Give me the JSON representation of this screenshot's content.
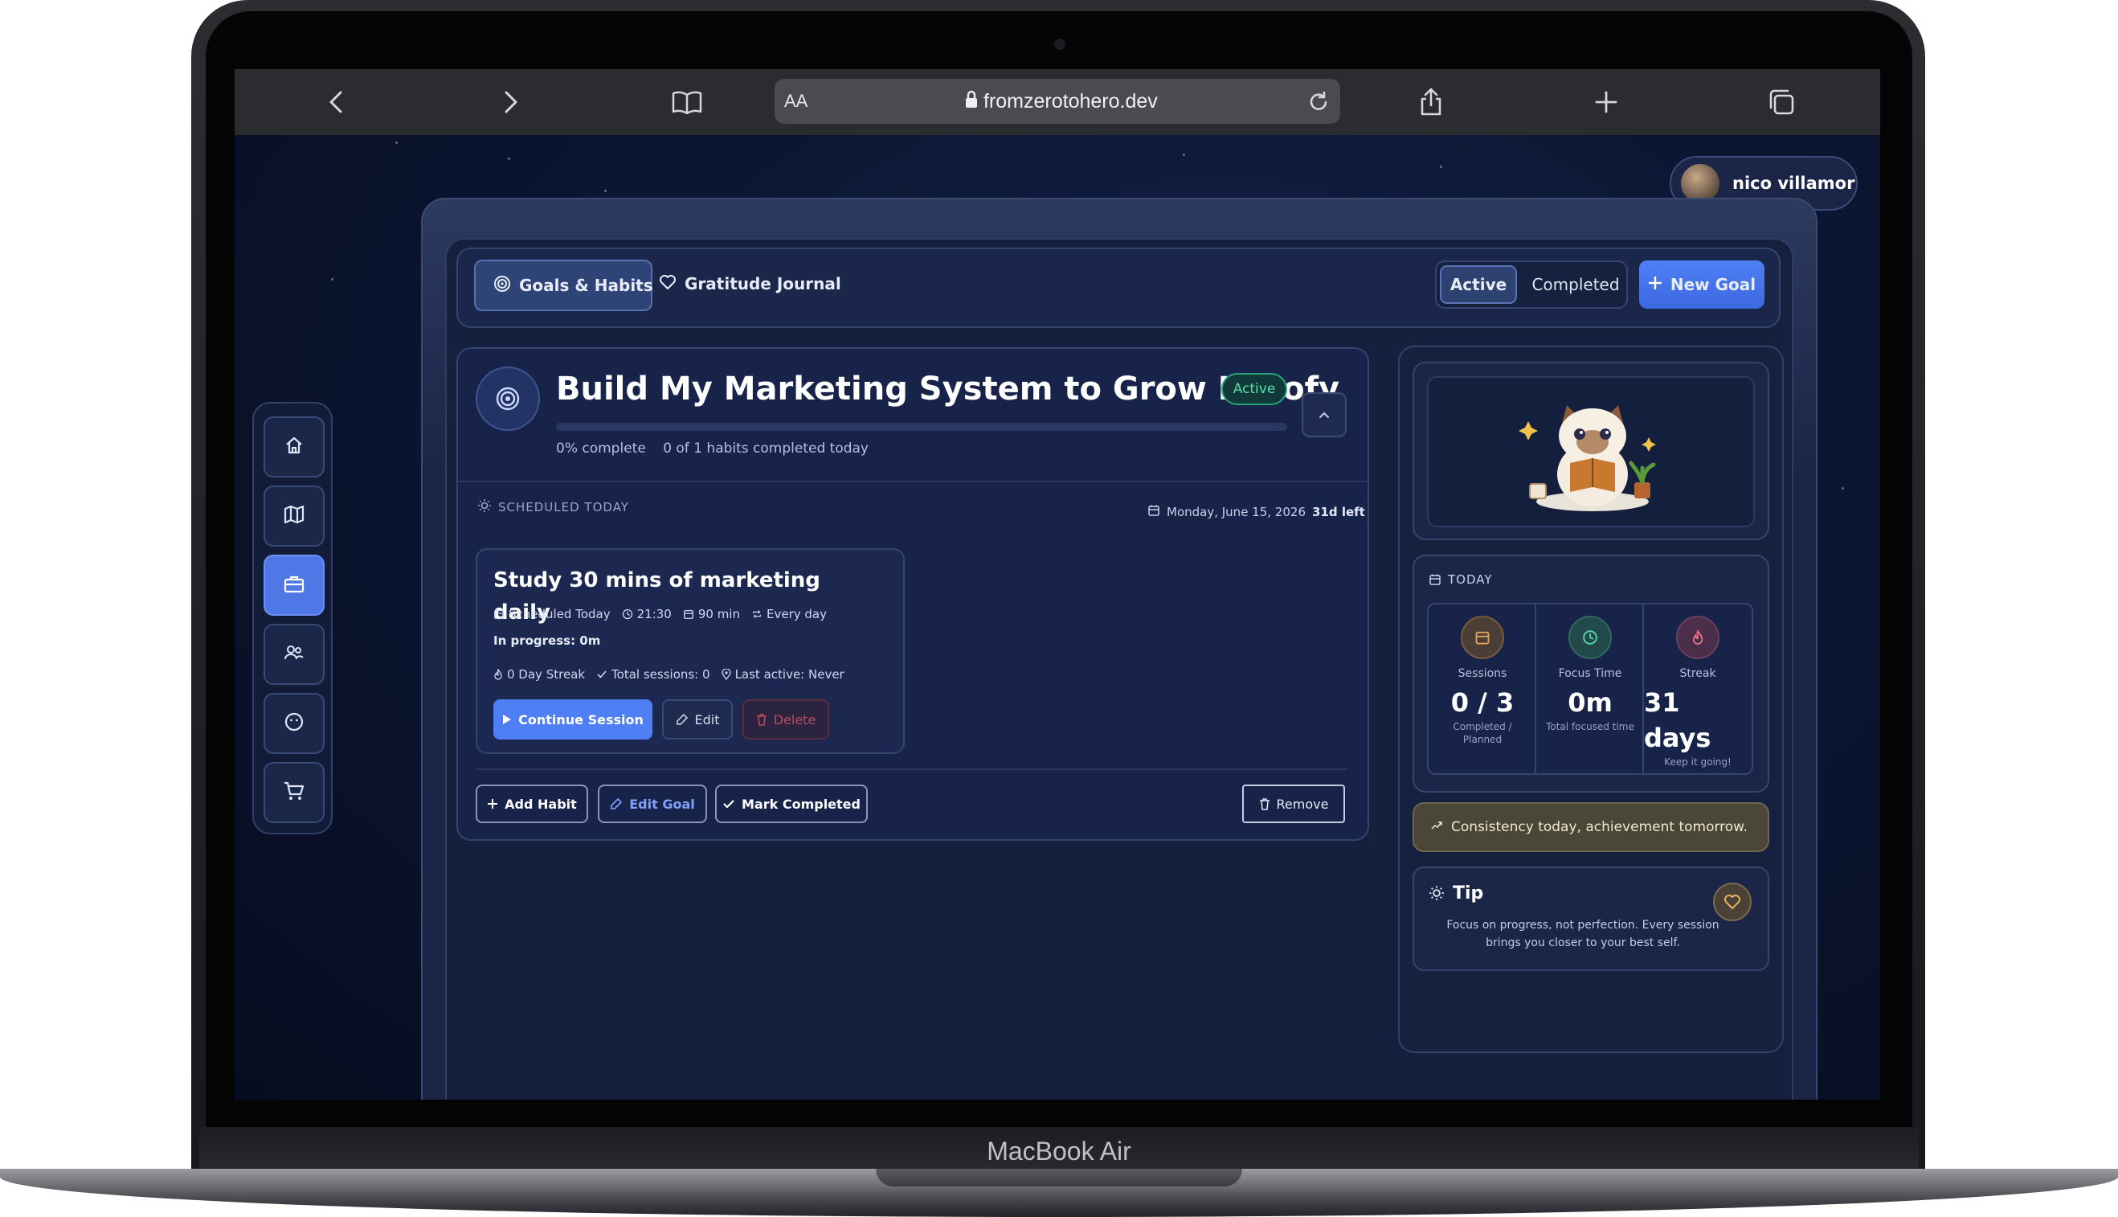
{
  "device": {
    "label": "MacBook Air"
  },
  "browser": {
    "text_size_label": "AA",
    "url": "fromzerotohero.dev",
    "icons": [
      "back-icon",
      "forward-icon",
      "bookmarks-icon",
      "lock-icon",
      "reload-icon",
      "share-icon",
      "new-tab-icon",
      "tabs-icon"
    ]
  },
  "user": {
    "name": "nico villamor"
  },
  "nav": {
    "tabs": [
      {
        "label": "Goals & Habits",
        "icon": "target-icon",
        "active": true
      },
      {
        "label": "Gratitude Journal",
        "icon": "heart-icon",
        "active": false
      }
    ],
    "filter": {
      "active_label": "Active",
      "completed_label": "Completed"
    },
    "new_goal_label": "New Goal"
  },
  "sidebar": {
    "items": [
      {
        "name": "home",
        "icon": "home-icon",
        "active": false
      },
      {
        "name": "map",
        "icon": "map-icon",
        "active": false
      },
      {
        "name": "goals",
        "icon": "briefcase-icon",
        "active": true
      },
      {
        "name": "community",
        "icon": "users-icon",
        "active": false
      },
      {
        "name": "profile",
        "icon": "smiley-icon",
        "active": false
      },
      {
        "name": "shop",
        "icon": "cart-icon",
        "active": false
      }
    ]
  },
  "goal": {
    "title": "Build My Marketing System to Grow Herofy",
    "status": "Active",
    "progress_percent": 0,
    "progress_label": "0% complete",
    "habits_today_label": "0 of 1 habits completed today",
    "scheduled_label": "SCHEDULED TODAY",
    "date": "Monday, June 15, 2026",
    "days_left": "31d left",
    "habit": {
      "title": "Study 30 mins of marketing daily",
      "scheduled": "Scheduled Today",
      "time": "21:30",
      "duration": "90 min",
      "frequency": "Every day",
      "in_progress": "In progress: 0m",
      "streak": "0 Day Streak",
      "total_sessions": "Total sessions: 0",
      "last_active": "Last active: Never",
      "continue_label": "Continue Session",
      "edit_label": "Edit",
      "delete_label": "Delete"
    },
    "actions": {
      "add_habit": "Add Habit",
      "edit_goal": "Edit Goal",
      "mark_completed": "Mark Completed",
      "remove": "Remove"
    }
  },
  "today": {
    "label": "TODAY",
    "stats": [
      {
        "label": "Sessions",
        "value": "0 / 3",
        "sub": "Completed / Planned",
        "icon": "calendar-icon",
        "color": "#7a5a3a"
      },
      {
        "label": "Focus Time",
        "value": "0m",
        "sub": "Total focused time",
        "icon": "clock-icon",
        "color": "#2f6a5e"
      },
      {
        "label": "Streak",
        "value": "31 days",
        "sub": "Keep it going!",
        "icon": "flame-icon",
        "color": "#6a4060"
      }
    ]
  },
  "quote": {
    "text": "Consistency today, achievement tomorrow."
  },
  "tip": {
    "title": "Tip",
    "text": "Focus on progress, not perfection. Every session brings you closer to your best self."
  },
  "colors": {
    "accent": "#4f7ff5",
    "active_badge": "#55e0a8",
    "delete": "#c24a5a",
    "background": "#0c1633"
  }
}
